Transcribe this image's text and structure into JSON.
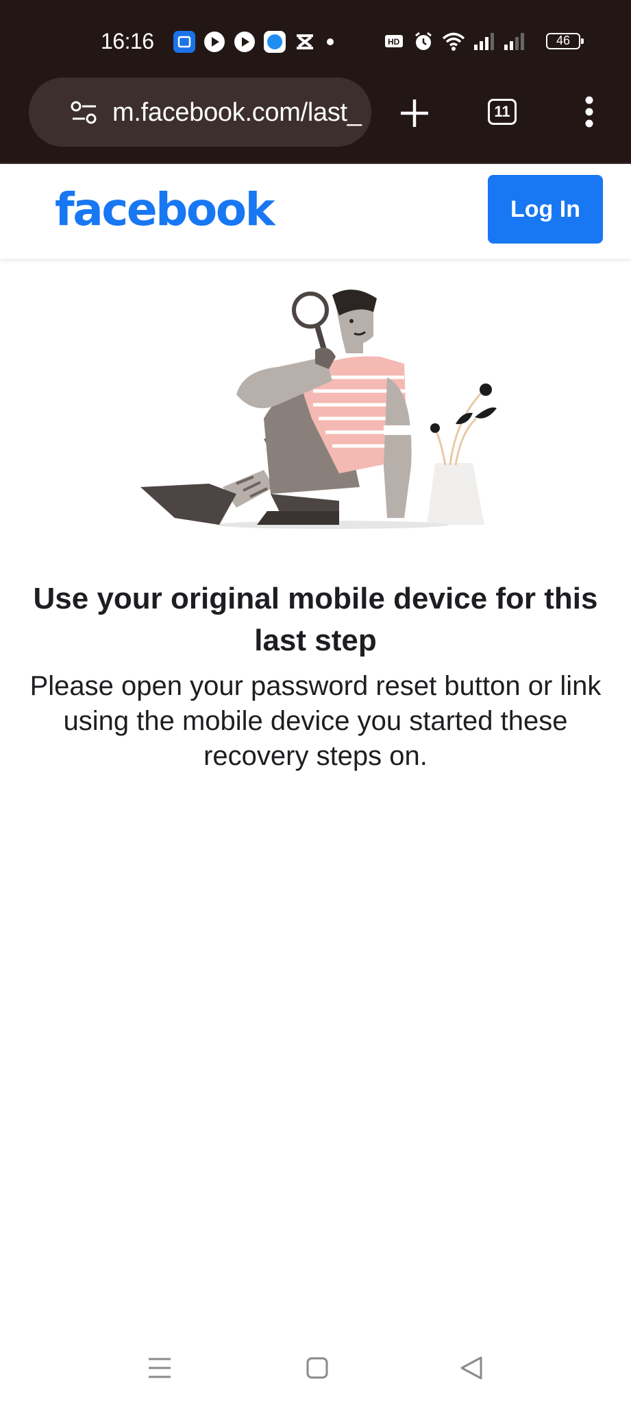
{
  "status_bar": {
    "time": "16:16",
    "battery": "46",
    "notification_icons": [
      "flashcard-app-icon",
      "play-icon",
      "play-icon",
      "messenger-icon",
      "capcut-icon",
      "dot-icon"
    ],
    "system_icons": [
      "volte-icon",
      "alarm-icon",
      "wifi-icon",
      "signal-icon",
      "signal-icon"
    ]
  },
  "browser": {
    "url": "m.facebook.com/last_",
    "tab_count": "11"
  },
  "header": {
    "logo": "facebook",
    "login_label": "Log In",
    "brand_color": "#1877f2"
  },
  "main": {
    "headline": "Use your original mobile device for this last step",
    "body": "Please open your password reset button or link using the mobile device you started these recovery steps on."
  },
  "nav": [
    "recents-icon",
    "home-icon",
    "back-icon"
  ]
}
